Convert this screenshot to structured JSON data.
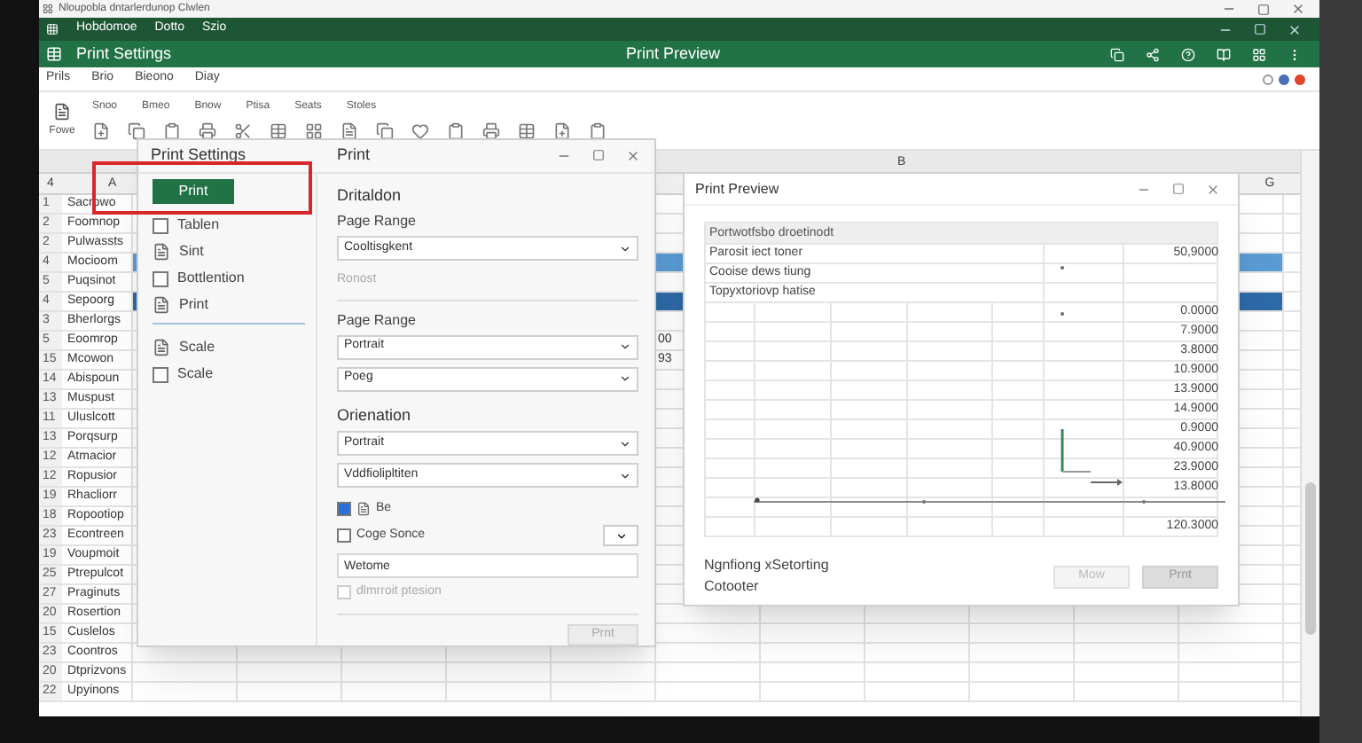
{
  "window": {
    "title": "Nloupobla dntarlerdunop Clwlen"
  },
  "app_bar": {
    "items": [
      "Hobdomoe",
      "Dotto",
      "Szio"
    ]
  },
  "header": {
    "title": "Print Settings",
    "center_title": "Print Preview"
  },
  "menu": [
    "Prils",
    "Brio",
    "Bieono",
    "Diay"
  ],
  "toolbar": {
    "button": "Fowe",
    "labels": [
      "Snoo",
      "Bmeo",
      "Bnow",
      "Ptisa",
      "Seats",
      "Stoles"
    ]
  },
  "sheet": {
    "top_column": "B",
    "corner": "4",
    "column_a": "A",
    "column_right": "G",
    "rows": [
      {
        "number": "1",
        "label": "Sacrowo"
      },
      {
        "number": "2",
        "label": "Foomnop"
      },
      {
        "number": "2",
        "label": "Pulwassts"
      },
      {
        "number": "4",
        "label": "Mocioom",
        "color": "#5b9bd5"
      },
      {
        "number": "5",
        "label": "Puqsinot"
      },
      {
        "number": "4",
        "label": "Sepoorg",
        "color": "#2e6aa8"
      },
      {
        "number": "3",
        "label": "Bherlorgs"
      },
      {
        "number": "5",
        "label": "Eoomrop",
        "value": "00"
      },
      {
        "number": "15",
        "label": "Mcowon",
        "value": "93"
      },
      {
        "number": "14",
        "label": "Abispoun"
      },
      {
        "number": "13",
        "label": "Muspust"
      },
      {
        "number": "11",
        "label": "Uluslcott"
      },
      {
        "number": "13",
        "label": "Porqsurp"
      },
      {
        "number": "12",
        "label": "Atmacior"
      },
      {
        "number": "12",
        "label": "Ropusior"
      },
      {
        "number": "19",
        "label": "Rhacliorr"
      },
      {
        "number": "18",
        "label": "Ropootiop"
      },
      {
        "number": "23",
        "label": "Econtreen"
      },
      {
        "number": "19",
        "label": "Voupmoit"
      },
      {
        "number": "25",
        "label": "Ptrepulcot"
      },
      {
        "number": "27",
        "label": "Praginuts"
      },
      {
        "number": "20",
        "label": "Rosertion"
      },
      {
        "number": "15",
        "label": "Cuslelos"
      },
      {
        "number": "23",
        "label": "Coontros"
      },
      {
        "number": "20",
        "label": "Dtprizvons"
      },
      {
        "number": "22",
        "label": "Upyinons"
      }
    ]
  },
  "print_settings": {
    "title": "Print Settings",
    "pane_title": "Print",
    "nav_groups": [
      [
        {
          "kind": "button",
          "label": "Print",
          "selected": true
        },
        {
          "kind": "checkbox",
          "label": "Tablen",
          "checked": false
        },
        {
          "kind": "page",
          "label": "Sint"
        },
        {
          "kind": "checkbox",
          "label": "Bottlention",
          "checked": false
        },
        {
          "kind": "page",
          "label": "Print"
        }
      ],
      [
        {
          "kind": "page",
          "label": "Scale"
        },
        {
          "kind": "checkbox",
          "label": "Scale",
          "checked": false
        }
      ]
    ],
    "fields": [
      {
        "kind": "heading",
        "text": "Dritaldon"
      },
      {
        "kind": "label",
        "text": "Page Range"
      },
      {
        "kind": "select",
        "value": "Cooltisgkent"
      },
      {
        "kind": "note",
        "text": "Ronost"
      },
      {
        "kind": "divider"
      },
      {
        "kind": "label",
        "text": "Page Range"
      },
      {
        "kind": "select",
        "value": "Portrait"
      },
      {
        "kind": "select",
        "value": "Poeg"
      },
      {
        "kind": "heading",
        "text": "Orienation"
      },
      {
        "kind": "select",
        "value": "Portrait"
      },
      {
        "kind": "select",
        "value": "Vddfiolipltiten"
      },
      {
        "kind": "check_icon",
        "label": "Be",
        "checked": true,
        "disabled": false
      },
      {
        "kind": "check_select",
        "label": "Coge Sonce",
        "checked": false,
        "disabled": false
      },
      {
        "kind": "input",
        "value": "Wetome"
      },
      {
        "kind": "check",
        "label": "dlmrroit ptesion",
        "checked": false,
        "disabled": true
      },
      {
        "kind": "divider"
      },
      {
        "kind": "button",
        "label": "Prnt",
        "disabled": true
      }
    ]
  },
  "print_preview": {
    "title": "Print Preview",
    "table_title": "Portwotfsbo droetinodt",
    "rows": [
      {
        "label": "Parosit iect toner",
        "value": "50,9000"
      },
      {
        "label": "Cooise dews tiung"
      },
      {
        "label": "Topyxtoriovp hatise"
      },
      {
        "value": "0.0000"
      },
      {
        "value": "7.9000"
      },
      {
        "value": "3.8000"
      },
      {
        "value": "10.9000"
      },
      {
        "value": "13.9000"
      },
      {
        "value": "14.9000"
      },
      {
        "value": "0.9000"
      },
      {
        "value": "40.9000"
      },
      {
        "value": "23.9000"
      },
      {
        "value": "13.8000"
      },
      {},
      {
        "value": "120.3000"
      }
    ],
    "footer_lines": [
      "Ngnfiong xSetorting",
      "Cotooter"
    ],
    "buttons": [
      {
        "label": "Mow",
        "disabled": true
      },
      {
        "label": "Prnt",
        "disabled": false
      }
    ]
  }
}
